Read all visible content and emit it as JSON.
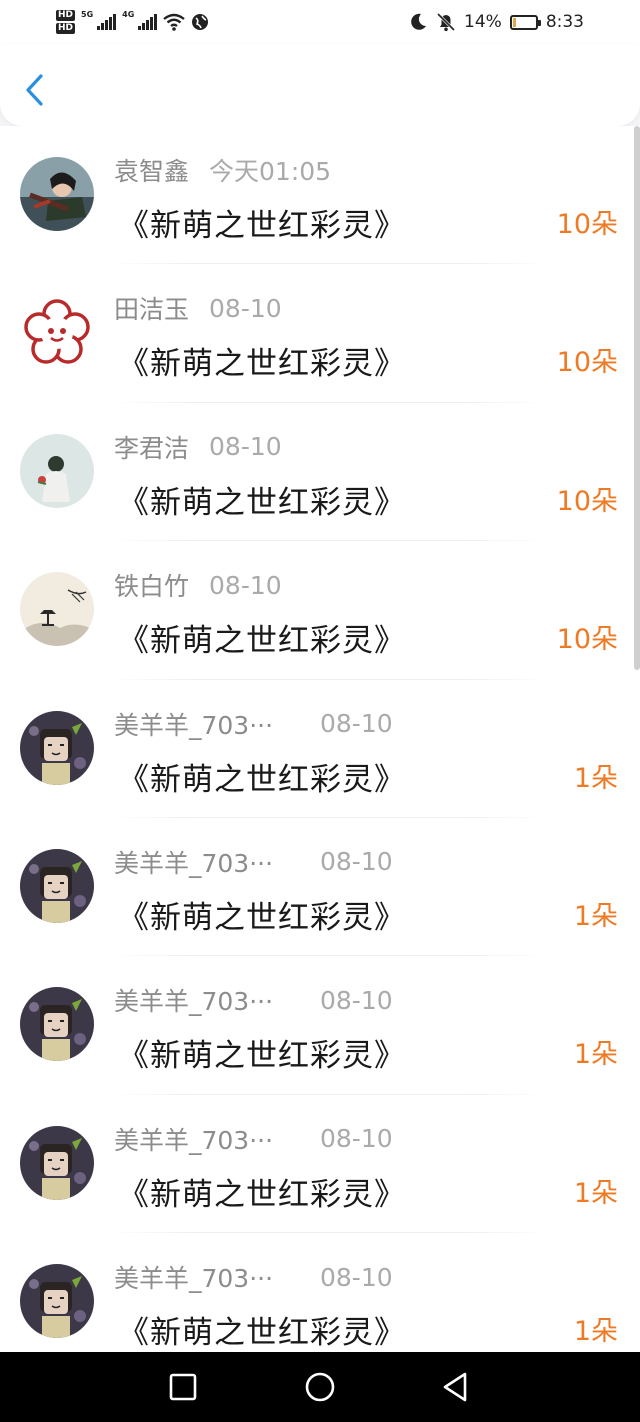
{
  "status_bar": {
    "hd_top": "HD",
    "hd_bottom": "HD",
    "net1": "5G",
    "net2": "4G",
    "battery_percent": "14%",
    "time": "8:33"
  },
  "colors": {
    "accent": "#2b8fe0",
    "count": "#ef7a24"
  },
  "entries": [
    {
      "name": "袁智鑫",
      "time": "今天01:05",
      "gift": "《新萌之世红彩灵》",
      "count": "10朵",
      "avatar": "avatar-warrior"
    },
    {
      "name": "田洁玉",
      "time": "08-10",
      "gift": "《新萌之世红彩灵》",
      "count": "10朵",
      "avatar": "avatar-flower"
    },
    {
      "name": "李君洁",
      "time": "08-10",
      "gift": "《新萌之世红彩灵》",
      "count": "10朵",
      "avatar": "avatar-girl"
    },
    {
      "name": "铁白竹",
      "time": "08-10",
      "gift": "《新萌之世红彩灵》",
      "count": "10朵",
      "avatar": "avatar-landscape"
    },
    {
      "name": "美羊羊_703···",
      "time": "08-10",
      "gift": "《新萌之世红彩灵》",
      "count": "1朵",
      "avatar": "avatar-cartoon"
    },
    {
      "name": "美羊羊_703···",
      "time": "08-10",
      "gift": "《新萌之世红彩灵》",
      "count": "1朵",
      "avatar": "avatar-cartoon"
    },
    {
      "name": "美羊羊_703···",
      "time": "08-10",
      "gift": "《新萌之世红彩灵》",
      "count": "1朵",
      "avatar": "avatar-cartoon"
    },
    {
      "name": "美羊羊_703···",
      "time": "08-10",
      "gift": "《新萌之世红彩灵》",
      "count": "1朵",
      "avatar": "avatar-cartoon"
    },
    {
      "name": "美羊羊_703···",
      "time": "08-10",
      "gift": "《新萌之世红彩灵》",
      "count": "1朵",
      "avatar": "avatar-cartoon"
    }
  ]
}
